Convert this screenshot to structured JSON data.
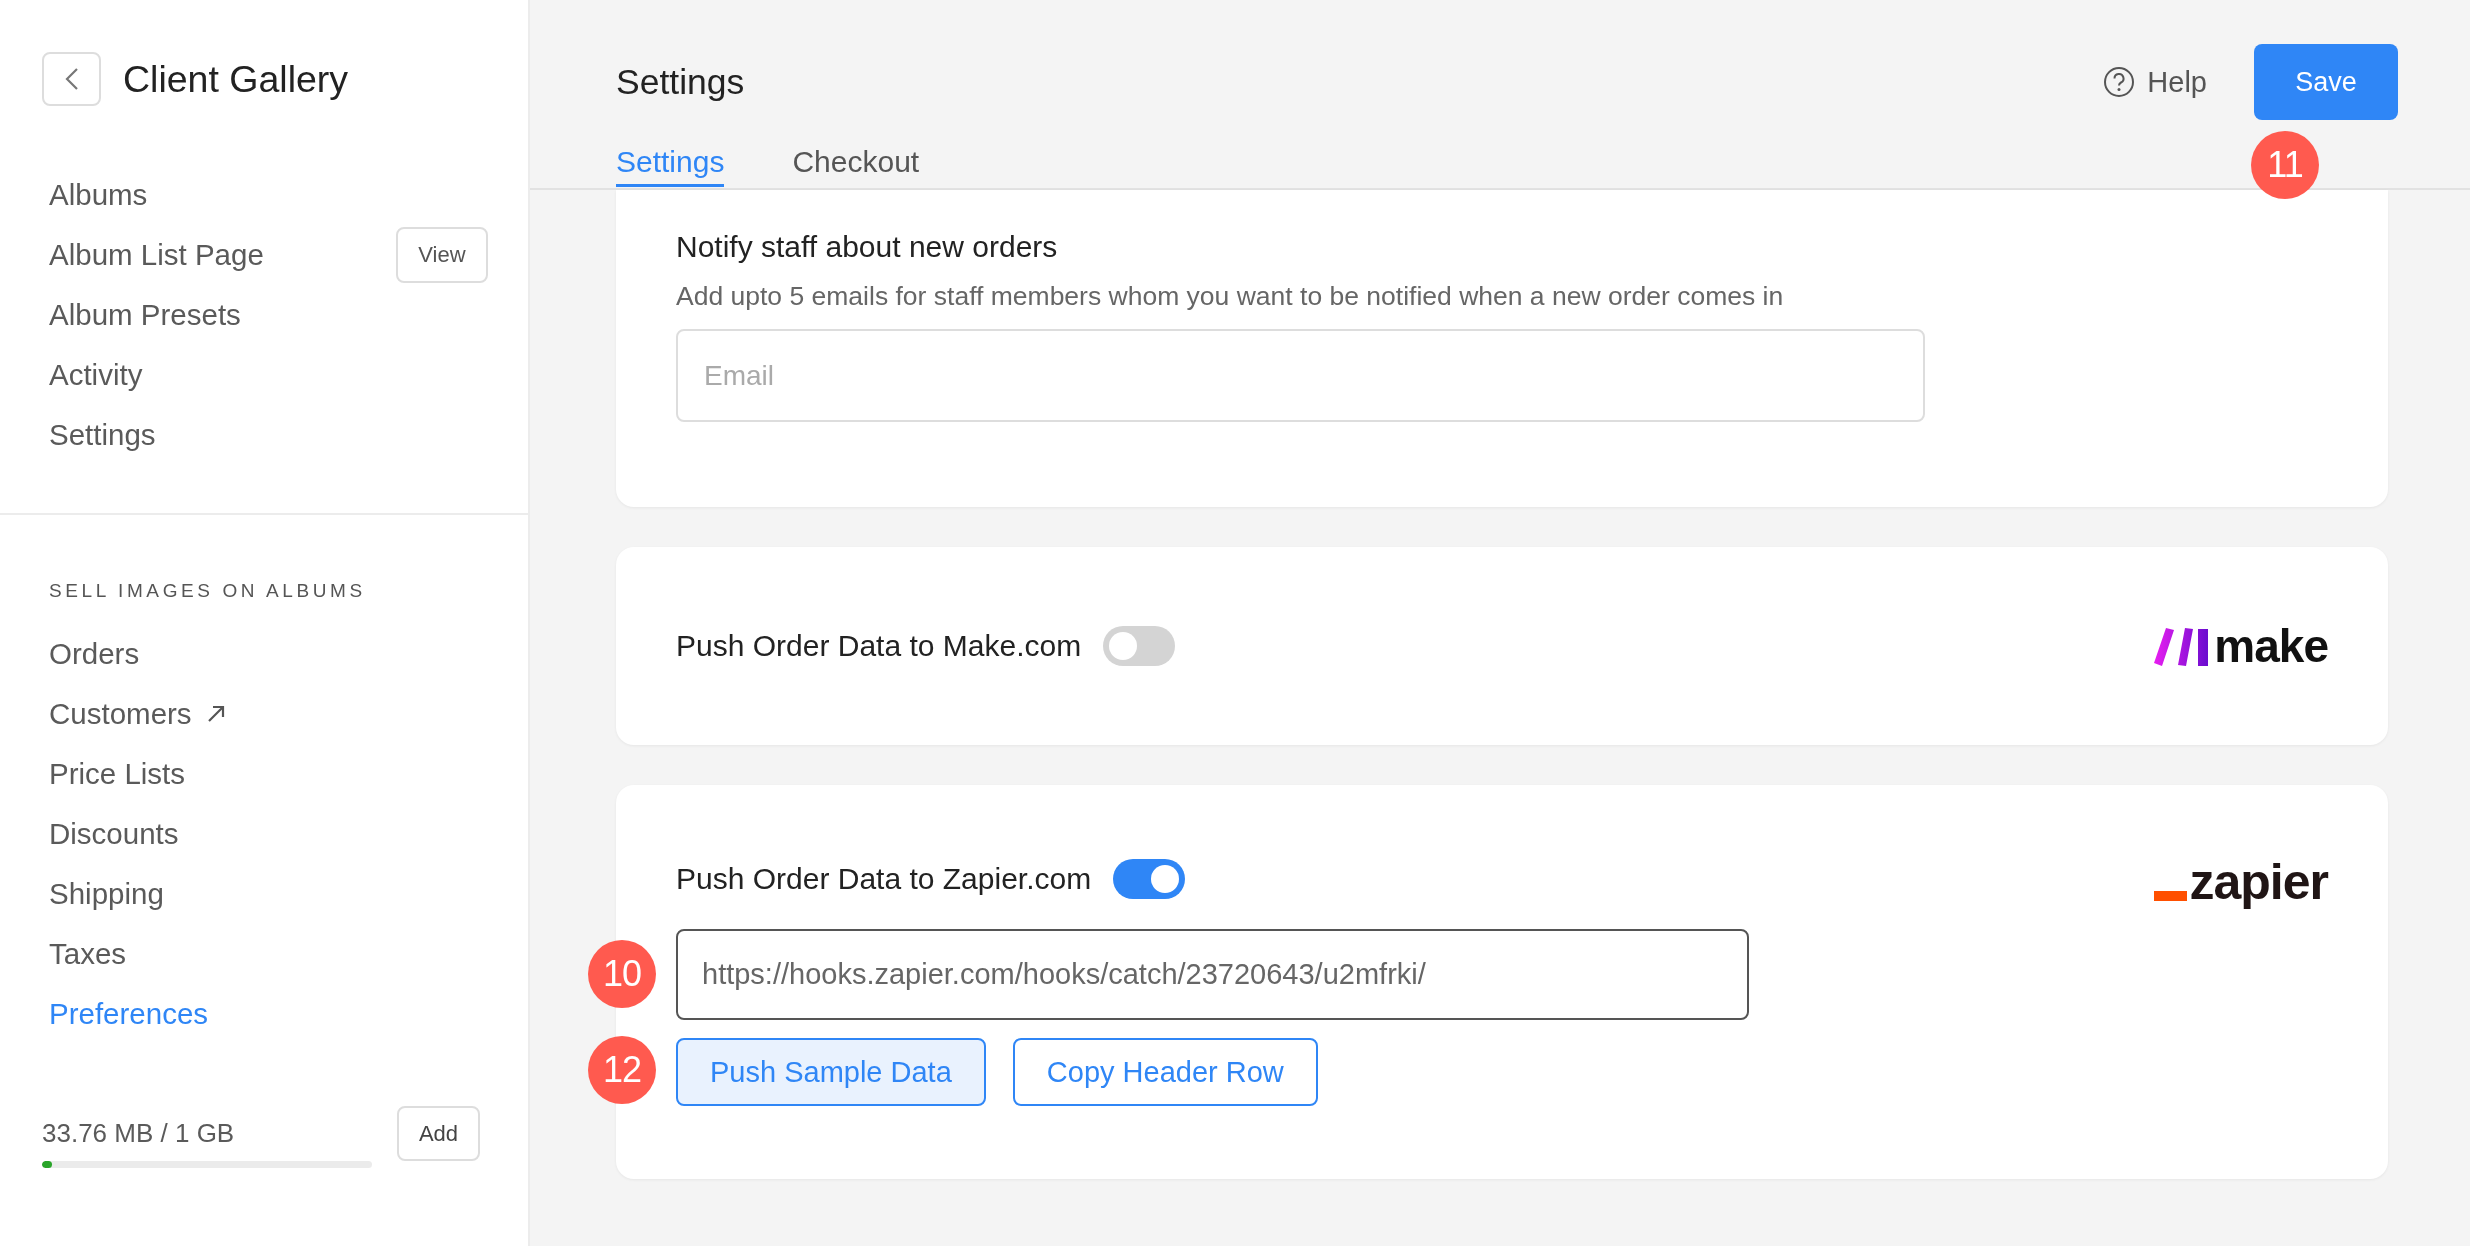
{
  "sidebar": {
    "title": "Client Gallery",
    "items": [
      {
        "label": "Albums",
        "selected": false
      },
      {
        "label": "Album List Page",
        "selected": false,
        "action": "View"
      },
      {
        "label": "Album Presets",
        "selected": false
      },
      {
        "label": "Activity",
        "selected": false
      },
      {
        "label": "Settings",
        "selected": false
      }
    ],
    "section": {
      "heading": "SELL IMAGES ON ALBUMS",
      "items": [
        {
          "label": "Orders",
          "selected": false,
          "external": false
        },
        {
          "label": "Customers",
          "selected": false,
          "external": true
        },
        {
          "label": "Price Lists",
          "selected": false,
          "external": false
        },
        {
          "label": "Discounts",
          "selected": false,
          "external": false
        },
        {
          "label": "Shipping",
          "selected": false,
          "external": false
        },
        {
          "label": "Taxes",
          "selected": false,
          "external": false
        },
        {
          "label": "Preferences",
          "selected": true,
          "external": false
        }
      ]
    },
    "storage": {
      "usage": "33.76 MB / 1 GB",
      "level": 0.03,
      "action": "Add"
    }
  },
  "header": {
    "title": "Settings",
    "help": "Help",
    "save": {
      "label": "Save",
      "marker": "11"
    },
    "tabs": [
      {
        "label": "Settings",
        "selected": true
      },
      {
        "label": "Checkout",
        "selected": false
      }
    ]
  },
  "cards": [
    {
      "kind": "emails",
      "title": "Notify staff about new orders",
      "description": "Add upto 5 emails for staff members whom you want to be notified when a new order comes in",
      "field": {
        "placeholder": "Email"
      }
    },
    {
      "kind": "integration",
      "title": "Push Order Data to Make.com",
      "on": false,
      "logo": {
        "kind": "make",
        "text": "make"
      }
    },
    {
      "kind": "integration",
      "title": "Push Order Data to Zapier.com",
      "on": true,
      "logo": {
        "kind": "zapier",
        "text": "zapier"
      },
      "field": {
        "value": "https://hooks.zapier.com/hooks/catch/23720643/u2mfrki/",
        "marker": "10"
      },
      "buttons": [
        {
          "label": "Push Sample Data",
          "primary": true,
          "marker": "12"
        },
        {
          "label": "Copy Header Row",
          "primary": false
        }
      ]
    }
  ]
}
